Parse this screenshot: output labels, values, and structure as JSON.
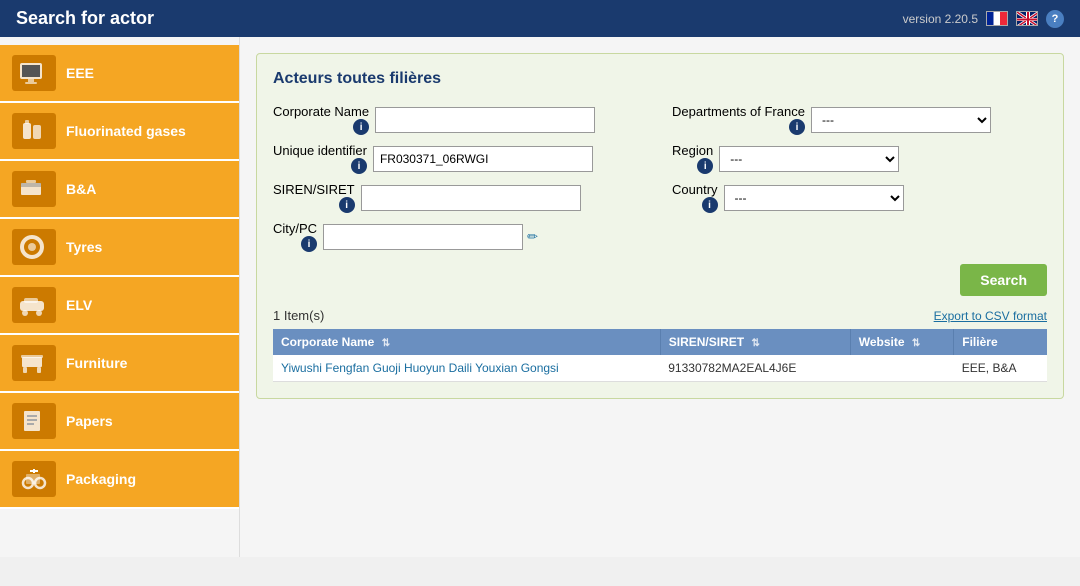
{
  "version": "version 2.20.5",
  "header": {
    "title": "Search for actor"
  },
  "sidebar": {
    "items": [
      {
        "id": "eee",
        "label": "EEE",
        "icon": "🖥"
      },
      {
        "id": "fluor",
        "label": "Fluorinated gases",
        "icon": "🔧"
      },
      {
        "id": "ba",
        "label": "B&A",
        "icon": "📦"
      },
      {
        "id": "tyres",
        "label": "Tyres",
        "icon": "⭕"
      },
      {
        "id": "elv",
        "label": "ELV",
        "icon": "🚗"
      },
      {
        "id": "furniture",
        "label": "Furniture",
        "icon": "🪑"
      },
      {
        "id": "papers",
        "label": "Papers",
        "icon": "📄"
      },
      {
        "id": "packaging",
        "label": "Packaging",
        "icon": "📦"
      }
    ]
  },
  "panel": {
    "title": "Acteurs toutes filières",
    "form": {
      "corporate_name_label": "Corporate Name",
      "unique_id_label": "Unique identifier",
      "unique_id_value": "FR030371_06RWGI",
      "siren_label": "SIREN/SIRET",
      "city_label": "City/PC",
      "dept_france_label": "Departments of France",
      "dept_france_value": "---",
      "region_label": "Region",
      "region_value": "---",
      "country_label": "Country",
      "country_value": "---"
    },
    "search_button": "Search",
    "export_link": "Export to CSV format",
    "item_count": "1 Item(s)",
    "table": {
      "headers": [
        {
          "label": "Corporate Name",
          "sortable": true
        },
        {
          "label": "SIREN/SIRET",
          "sortable": true
        },
        {
          "label": "Website",
          "sortable": true
        },
        {
          "label": "Filière",
          "sortable": false
        }
      ],
      "rows": [
        {
          "corporate_name": "Yiwushi Fengfan Guoji Huoyun Daili Youxian Gongsi",
          "siren": "91330782MA2EAL4J6E",
          "website": "",
          "filiere": "EEE, B&A"
        }
      ]
    }
  },
  "flags": {
    "fr_alt": "French",
    "uk_alt": "English"
  }
}
